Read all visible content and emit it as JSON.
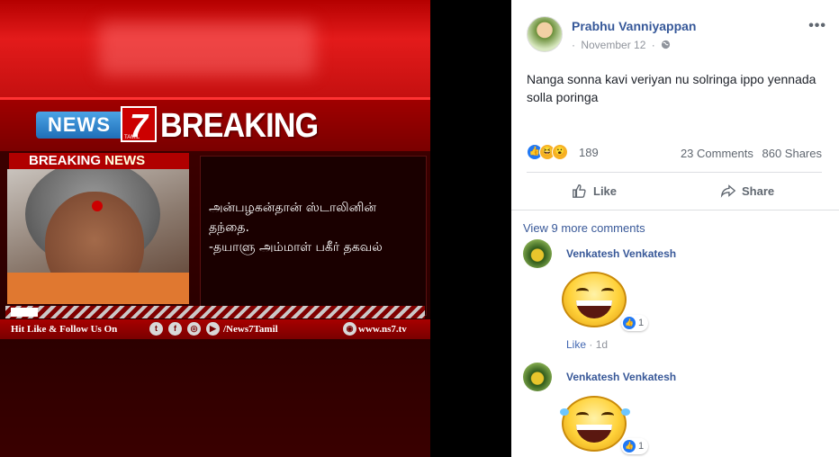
{
  "image": {
    "logo_word": "NEWS",
    "logo_number": "7",
    "logo_sub": "TAMIL",
    "headline": "BREAKING NEWS",
    "sub_label_a": "BREAKING",
    "sub_label_b": "NEWS",
    "quote_line1": "அன்பழகன்தான் ஸ்டாலினின்",
    "quote_line2": "தந்தை.",
    "quote_line3": "-தயாளு அம்மாள் பகீர் தகவல்",
    "follow_text": "Hit Like & Follow Us On",
    "handle": "/News7Tamil",
    "website": "www.ns7.tv"
  },
  "post": {
    "author": "Prabhu Vanniyappan",
    "date": "November 12",
    "separator": "·",
    "privacy_icon": "globe-icon",
    "more_icon": "•••",
    "text": "Nanga sonna kavi veriyan nu solringa ippo yennada solla poringa",
    "reaction_count": "189",
    "comments_count": "23 Comments",
    "shares_count": "860 Shares",
    "like_label": "Like",
    "share_label": "Share"
  },
  "comments": {
    "view_more": "View 9 more comments",
    "items": [
      {
        "name": "Venkatesh Venkatesh",
        "reactions": "1",
        "like_label": "Like",
        "time": "1d"
      },
      {
        "name": "Venkatesh Venkatesh",
        "reactions": "1"
      }
    ]
  },
  "colors": {
    "link_blue": "#365899",
    "like_blue": "#2078f4",
    "news_red": "#c00000"
  }
}
